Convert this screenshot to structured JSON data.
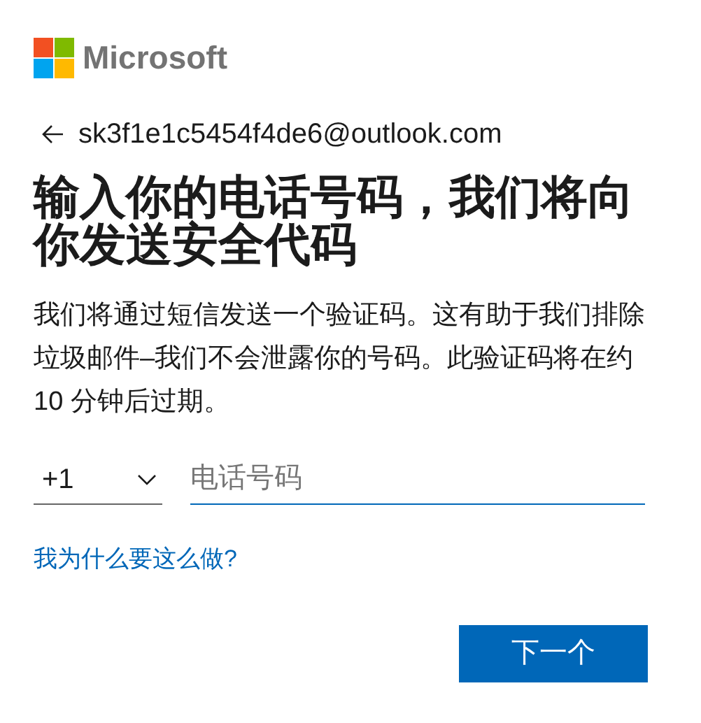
{
  "logo": {
    "text": "Microsoft"
  },
  "identity": {
    "email": "sk3f1e1c5454f4de6@outlook.com"
  },
  "title": "输入你的电话号码，我们将向你发送安全代码",
  "description": "我们将通过短信发送一个验证码。这有助于我们排除垃圾邮件–我们不会泄露你的号码。此验证码将在约 10 分钟后过期。",
  "country_code": {
    "value": "+1"
  },
  "phone": {
    "placeholder": "电话号码"
  },
  "help_link": "我为什么要这么做?",
  "buttons": [
    "下一个"
  ]
}
